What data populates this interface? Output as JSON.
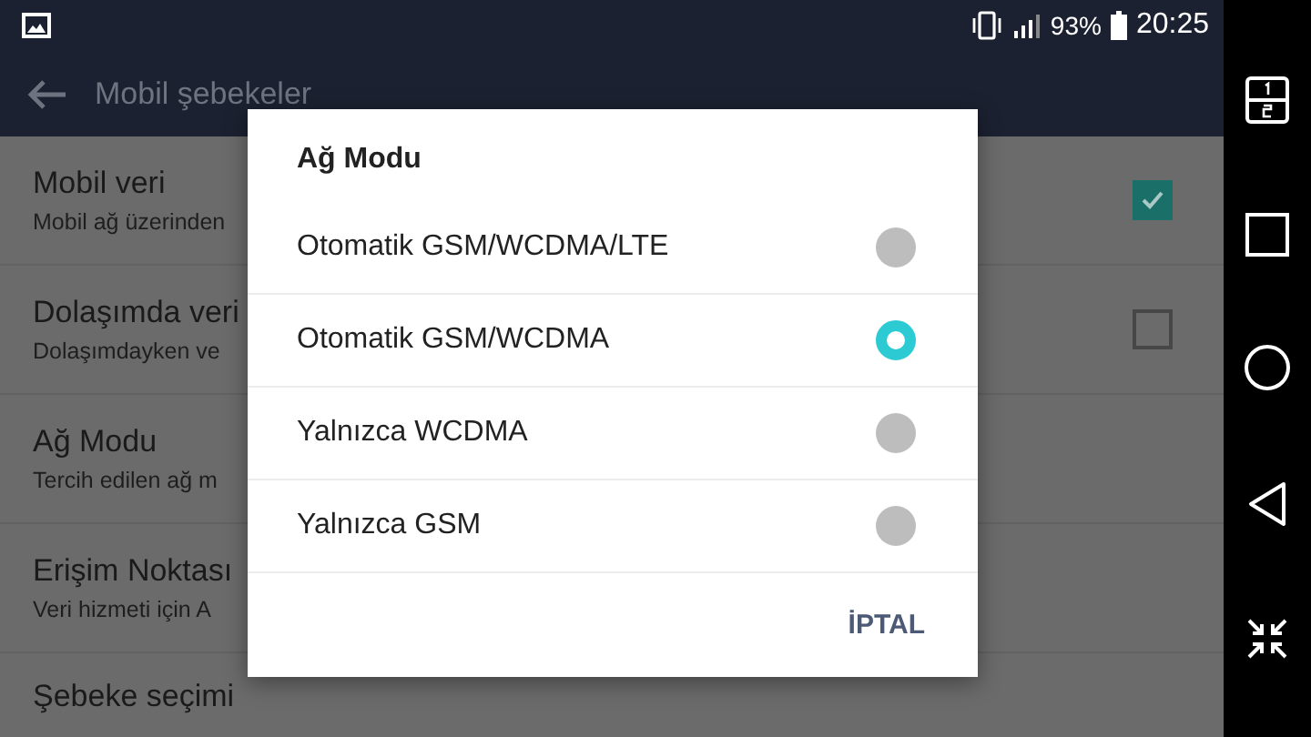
{
  "status_bar": {
    "battery": "93%",
    "time": "20:25"
  },
  "header": {
    "title": "Mobil şebekeler"
  },
  "settings": [
    {
      "title": "Mobil veri",
      "subtitle": "Mobil ağ üzerinden",
      "kind": "checkbox",
      "checked": true
    },
    {
      "title": "Dolaşımda veri",
      "subtitle": "Dolaşımdayken ve",
      "kind": "checkbox",
      "checked": false
    },
    {
      "title": "Ağ Modu",
      "subtitle": "Tercih edilen ağ m",
      "kind": "plain"
    },
    {
      "title": "Erişim Noktası",
      "subtitle": "Veri hizmeti için A",
      "kind": "plain"
    },
    {
      "title": "Şebeke seçimi",
      "kind": "plain"
    }
  ],
  "dialog": {
    "title": "Ağ Modu",
    "options": [
      {
        "label": "Otomatik GSM/WCDMA/LTE",
        "selected": false
      },
      {
        "label": "Otomatik GSM/WCDMA",
        "selected": true
      },
      {
        "label": "Yalnızca WCDMA",
        "selected": false
      },
      {
        "label": "Yalnızca GSM",
        "selected": false
      }
    ],
    "cancel": "İPTAL"
  }
}
